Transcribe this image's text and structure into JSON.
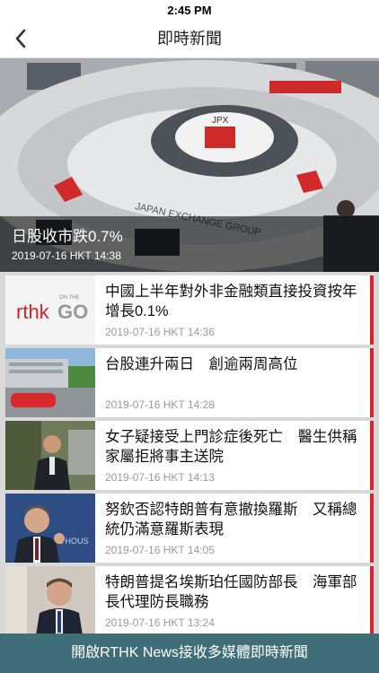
{
  "status_bar": {
    "time": "2:45 PM"
  },
  "nav": {
    "title": "即時新聞",
    "back_icon": "chevron-left-icon"
  },
  "hero": {
    "headline": "日股收市跌0.7%",
    "time": "2019-07-16 HKT 14:38",
    "sign_brand": "JPX",
    "sign_text": "JAPAN EXCHANGE GROUP"
  },
  "news": [
    {
      "title": "中國上半年對外非金融類直接投資按年增長0.1%",
      "time": "2019-07-16 HKT 14:36",
      "logo": {
        "brand": "rthk",
        "go": "GO",
        "tag": "ON THE"
      }
    },
    {
      "title": "台股連升兩日　創逾兩周高位",
      "time": "2019-07-16 HKT 14:28"
    },
    {
      "title": "女子疑接受上門診症後死亡　醫生供稱家屬拒將事主送院",
      "time": "2019-07-16 HKT 14:13"
    },
    {
      "title": "努欽否認特朗普有意撤換羅斯　又稱總統仍滿意羅斯表現",
      "time": "2019-07-16 HKT 14:05",
      "thumb_text": "E HOUS"
    },
    {
      "title": "特朗普提名埃斯珀任國防部長　海軍部長代理防長職務",
      "time": "2019-07-16 HKT 13:24"
    }
  ],
  "banner": {
    "text": "開啟RTHK News接收多媒體即時新聞"
  },
  "colors": {
    "accent": "#d8232a",
    "banner": "#3f6d78"
  }
}
